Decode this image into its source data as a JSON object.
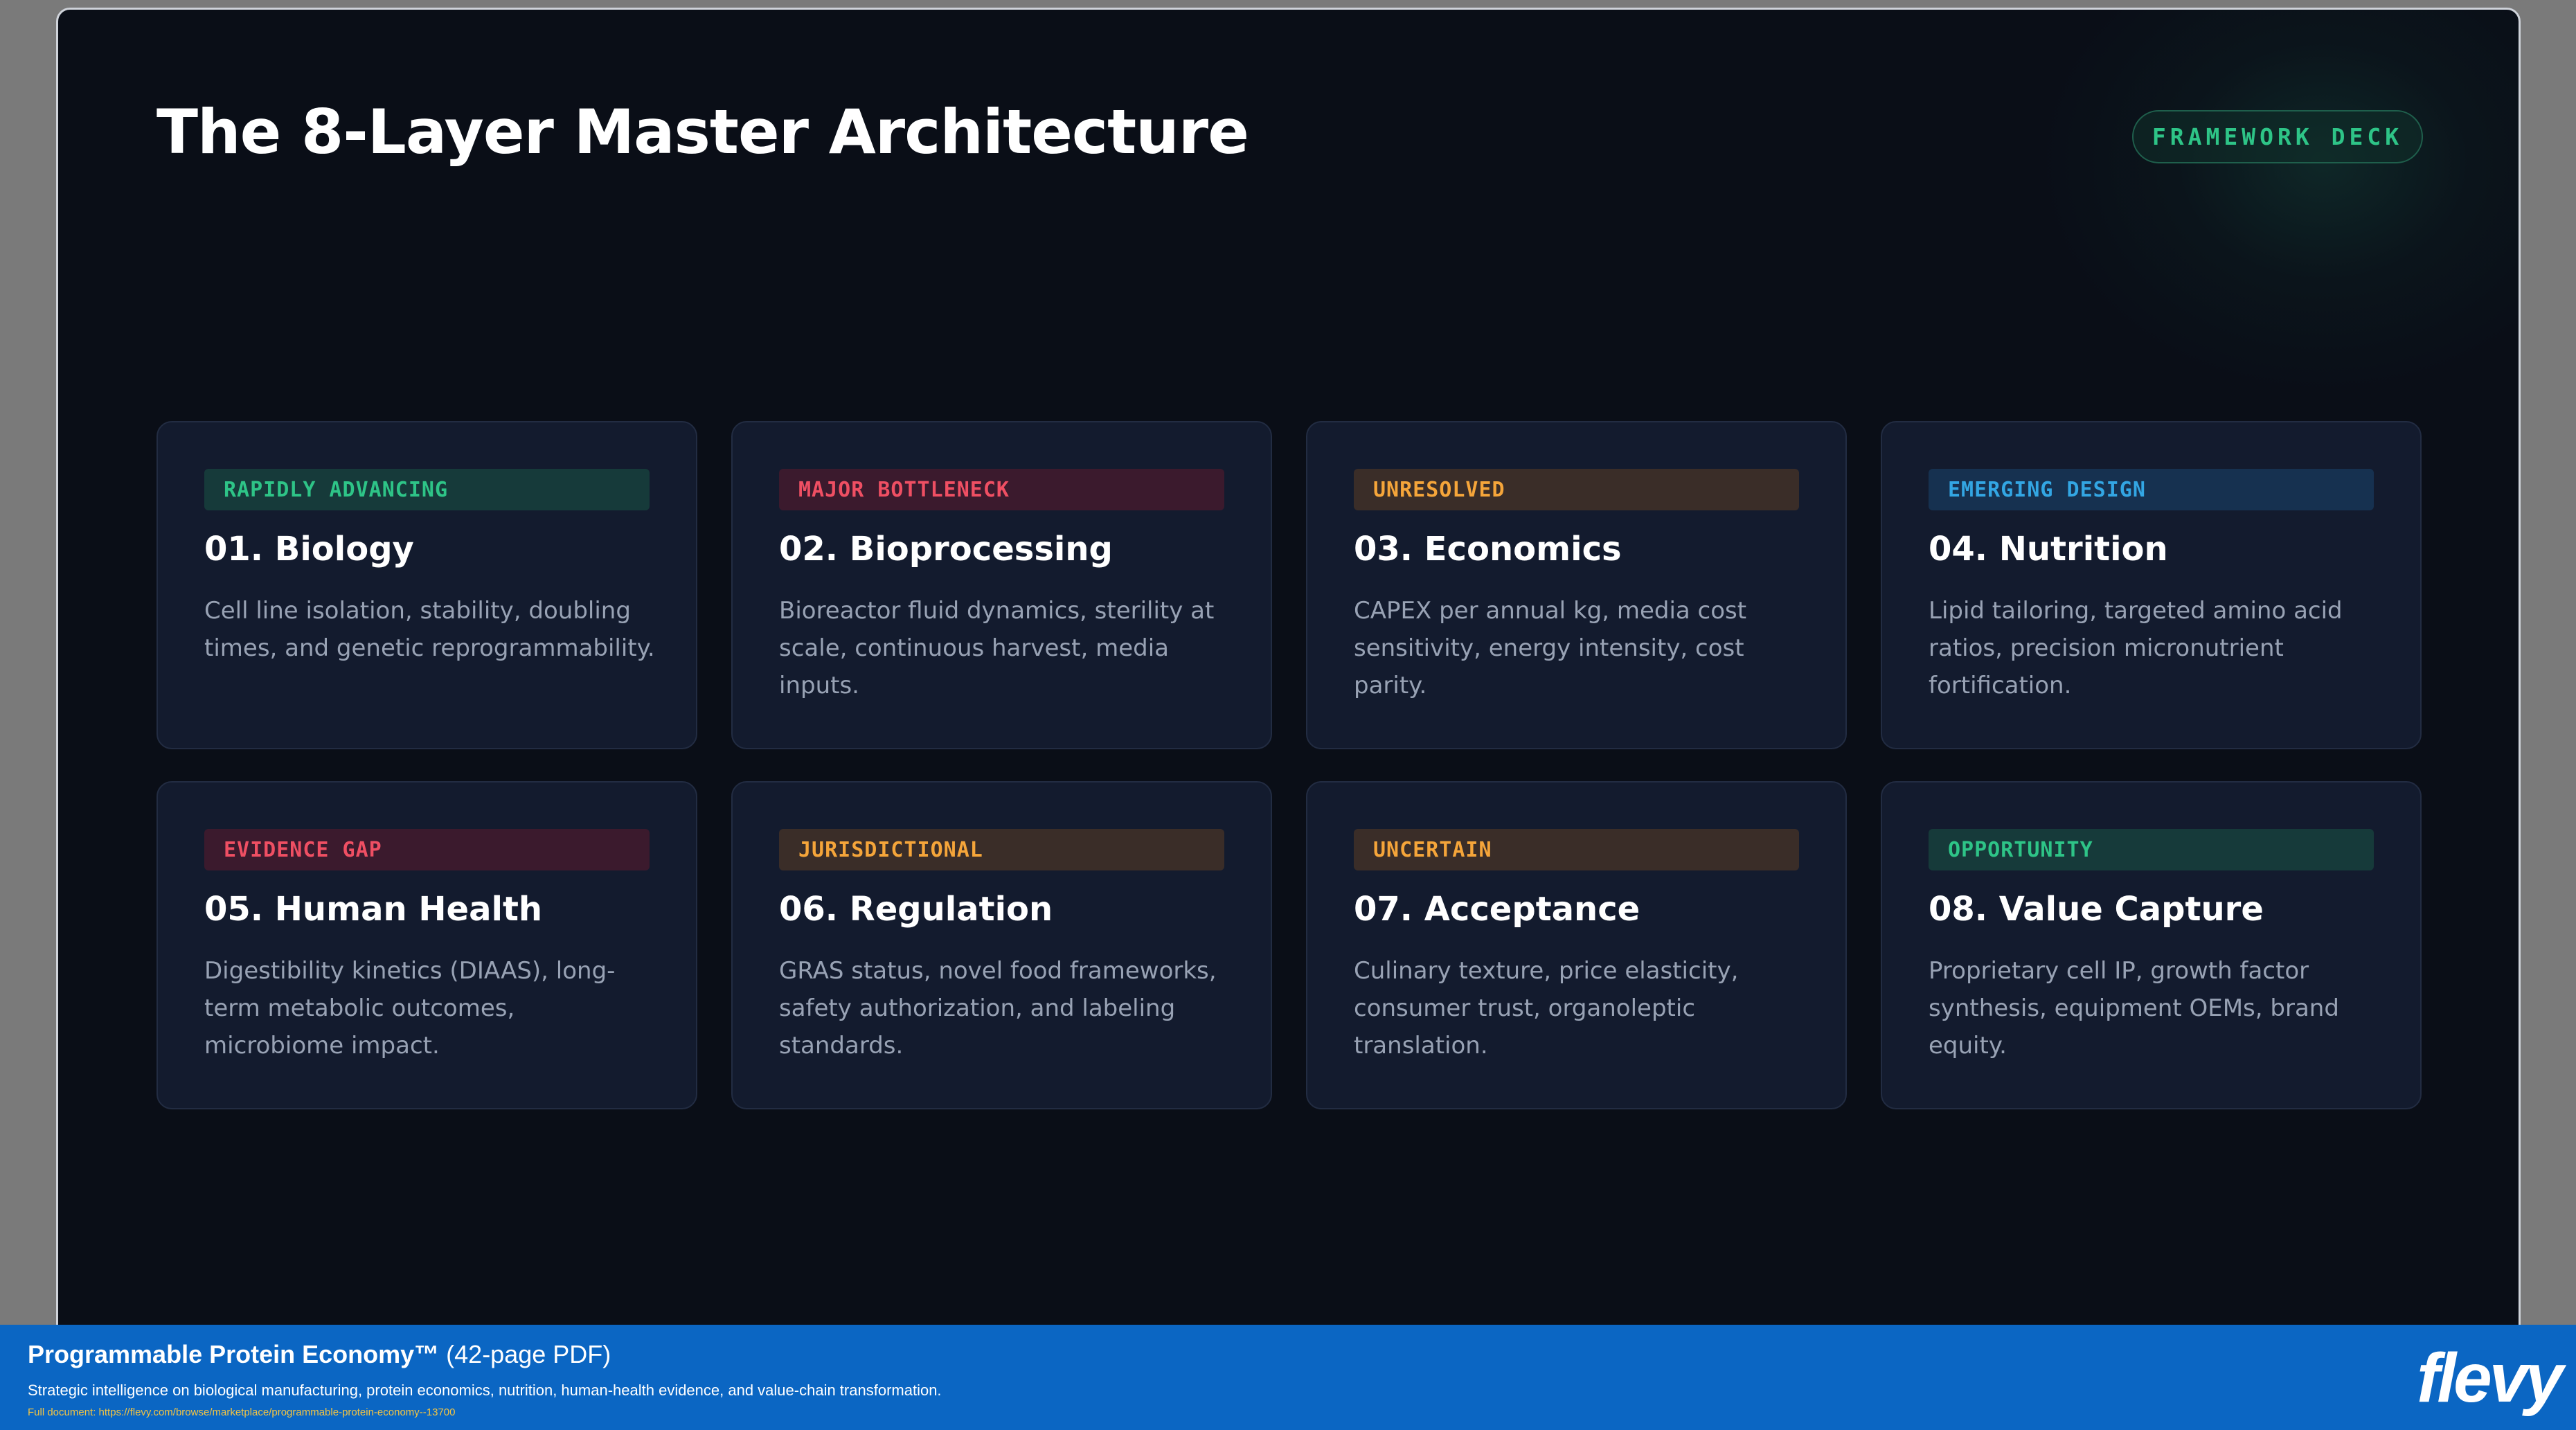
{
  "slide": {
    "title": "The 8-Layer Master Architecture",
    "badge": "FRAMEWORK DECK"
  },
  "cards": [
    {
      "tag": "RAPIDLY ADVANCING",
      "tag_color": "#2ec487",
      "title": "01. Biology",
      "description": "Cell line isolation, stability, doubling times, and genetic reprogrammability."
    },
    {
      "tag": "MAJOR BOTTLENECK",
      "tag_color": "#ef4f63",
      "title": "02. Bioprocessing",
      "description": "Bioreactor fluid dynamics, sterility at scale, continuous harvest, media inputs."
    },
    {
      "tag": "UNRESOLVED",
      "tag_color": "#f5a53a",
      "title": "03. Economics",
      "description": "CAPEX per annual kg, media cost sensitivity, energy intensity, cost parity."
    },
    {
      "tag": "EMERGING DESIGN",
      "tag_color": "#33a6e3",
      "title": "04. Nutrition",
      "description": "Lipid tailoring, targeted amino acid ratios, precision micronutrient fortification."
    },
    {
      "tag": "EVIDENCE GAP",
      "tag_color": "#ef4f63",
      "title": "05. Human Health",
      "description": "Digestibility kinetics (DIAAS), long-term metabolic outcomes, microbiome impact."
    },
    {
      "tag": "JURISDICTIONAL",
      "tag_color": "#f5a53a",
      "title": "06. Regulation",
      "description": "GRAS status, novel food frameworks, safety authorization, and labeling standards."
    },
    {
      "tag": "UNCERTAIN",
      "tag_color": "#f5a53a",
      "title": "07. Acceptance",
      "description": "Culinary texture, price elasticity, consumer trust, organoleptic translation."
    },
    {
      "tag": "OPPORTUNITY",
      "tag_color": "#2ec487",
      "title": "08. Value Capture",
      "description": "Proprietary cell IP, growth factor synthesis, equipment OEMs, brand equity."
    }
  ],
  "footer": {
    "title": "Programmable Protein Economy™",
    "title_suffix": "(42-page PDF)",
    "subtitle": "Strategic intelligence on biological manufacturing, protein economics, nutrition, human-health evidence, and value-chain transformation.",
    "link": "Full document: https://flevy.com/browse/marketplace/programmable-protein-economy--13700",
    "brand": "flevy"
  }
}
